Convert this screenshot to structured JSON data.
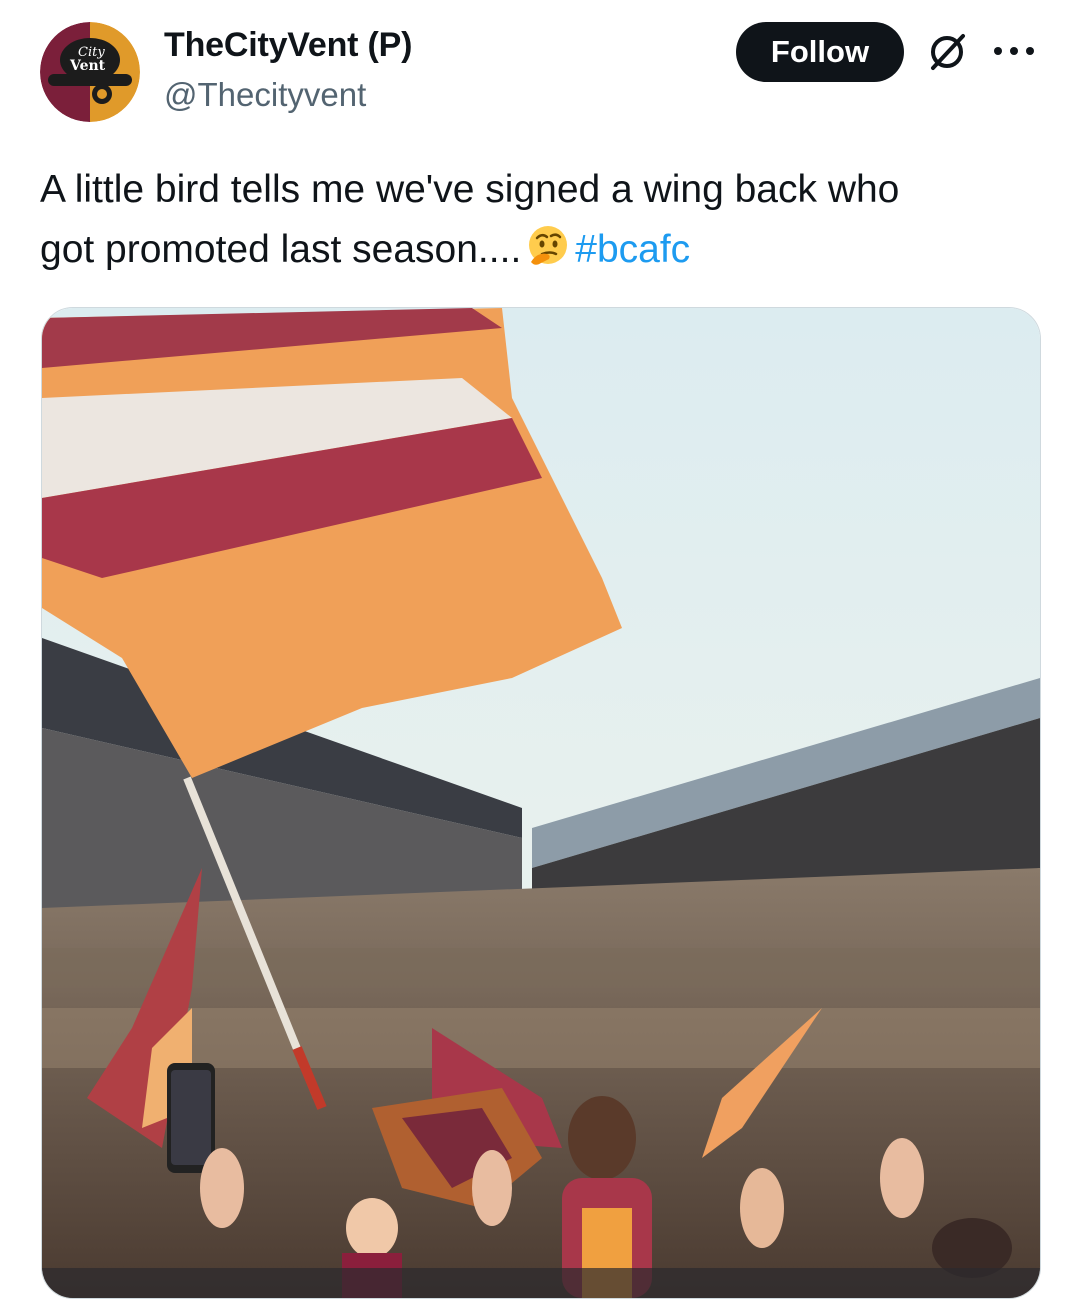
{
  "author": {
    "display_name": "TheCityVent (P)",
    "handle": "@Thecityvent",
    "avatar_icon": "thecityvent-logo-avatar",
    "avatar_text": "the city vent"
  },
  "actions": {
    "follow_label": "Follow",
    "grok_icon": "grok-icon",
    "more_icon": "more-horizontal-icon"
  },
  "tweet": {
    "line1": "A little bird tells me we've signed a wing back who",
    "line2": "got promoted last season....",
    "emoji": "thinking-face-emoji",
    "hashtag": "#bcafc"
  },
  "media": {
    "type": "photo",
    "subject": "football-celebration-stadium-flag"
  },
  "colors": {
    "link": "#1d9bf0",
    "follow_bg": "#0f1419",
    "secondary_text": "#536471",
    "claret": "#8b1f3c",
    "amber": "#f0a050"
  }
}
